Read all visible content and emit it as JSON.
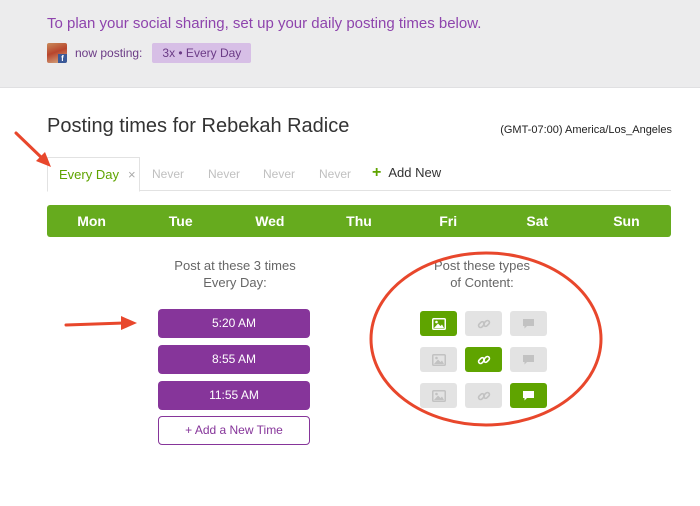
{
  "banner": {
    "text": "To plan your social sharing, set up your daily posting times below.",
    "now_posting_label": "now posting:",
    "frequency_badge": "3x • Every Day"
  },
  "page": {
    "title": "Posting times for Rebekah Radice",
    "timezone": "(GMT-07:00) America/Los_Angeles"
  },
  "tabs": {
    "active_label": "Every Day",
    "close_glyph": "×",
    "inactive": [
      "Never",
      "Never",
      "Never",
      "Never"
    ],
    "add_new_label": "Add New",
    "add_new_glyph": "+"
  },
  "days": [
    "Mon",
    "Tue",
    "Wed",
    "Thu",
    "Fri",
    "Sat",
    "Sun"
  ],
  "times": {
    "heading_line1": "Post at these 3 times",
    "heading_line2": "Every Day:",
    "slots": [
      "5:20 AM",
      "8:55 AM",
      "11:55 AM"
    ],
    "add_label": "+ Add a New Time"
  },
  "content_types": {
    "heading_line1": "Post these types",
    "heading_line2": "of Content:",
    "columns": [
      "image-icon",
      "link-icon",
      "comment-icon"
    ],
    "grid": [
      [
        true,
        false,
        false
      ],
      [
        false,
        true,
        false
      ],
      [
        false,
        false,
        true
      ]
    ]
  },
  "colors": {
    "accent_green": "#5fa400",
    "accent_purple": "#86359a",
    "annotation_red": "#e8472c"
  }
}
